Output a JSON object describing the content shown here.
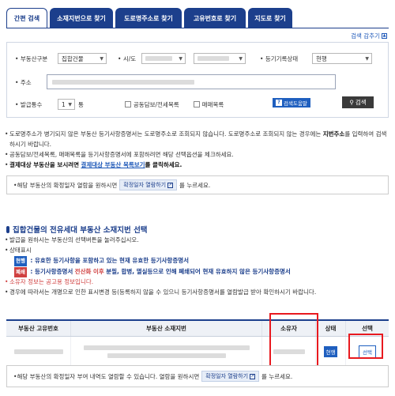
{
  "tabs": [
    {
      "label": "간편 검색",
      "active": true
    },
    {
      "label": "소재지번으로 찾기",
      "active": false
    },
    {
      "label": "도로명주소로 찾기",
      "active": false
    },
    {
      "label": "고유번호로 찾기",
      "active": false
    },
    {
      "label": "지도로 찾기",
      "active": false
    }
  ],
  "search_tip": "검색 감추기",
  "form": {
    "property_type_label": "부동산구분",
    "property_type_value": "집합건물",
    "sido_label": "시/도",
    "registry_status_label": "등기기록상태",
    "registry_status_value": "현행",
    "address_label": "주소",
    "issue_count_label": "발급통수",
    "issue_count_value": "1",
    "issue_unit": "통",
    "joint_collateral": "공동담보/전세목록",
    "trade_list": "매매목록",
    "help_button": "검색도움말",
    "search_button": "검색"
  },
  "notes": {
    "n1": "도로명주소가 병기되지 않은 부동산 등기사항증명서는 도로명주소로 조회되지 않습니다. 도로명주소로 조회되지 않는 경우에는",
    "n1_bold": "지번주소",
    "n1_tail": "를 입력하여 검색하시기 바랍니다.",
    "n2": "공동담보/전세목록, 매매목록을 등기사항증명서에 포함하려면 해당 선택옵션을 체크하세요.",
    "n3_bold": "결제대상 부동산을 보시려면",
    "n3_link": "결제대상 부동산 목록보기",
    "n3_tail": "를 클릭하세요."
  },
  "info1": {
    "prefix": "해당 부동산의 확정일자 열람을 원하시면",
    "button": "확정일자 열람하기",
    "suffix": "를 누르세요."
  },
  "section": {
    "title": "집합건물의 전유세대 부동산 소재지번 선택",
    "l1": "발급을 원하시는 부동산의 선택버튼을 눌러주십시오.",
    "l2": "상태표시",
    "badge_current": "현행",
    "desc_current": ": 유효한 등기사항을 포함하고 있는 현재 유효한 등기사항증명서",
    "badge_closed": "폐쇄",
    "desc_closed_a": ": 등기사항증명서",
    "desc_closed_red": "전산화 이후",
    "desc_closed_b": "분필, 합병, 멸실등으로 인해 폐쇄되어 현재 유효하지 않은 등기사항증명서",
    "l3_red": "소유자 정보는 공고용 정보입니다.",
    "l4": "경우에 따라서는 개명으로 인한 표시변경 등(등록하지 않을 수 있으니 등기사항증명서를 열람발급 받아 확인하시기 바랍니다."
  },
  "table": {
    "headers": [
      "부동산 고유번호",
      "부동산 소재지번",
      "소유자",
      "상태",
      "선택"
    ],
    "row": {
      "status": "현행",
      "select": "선택"
    }
  },
  "info2": {
    "prefix": "해당 부동산의 확정일자 부여 내역도 열람할 수 있습니다. 열람을 원하시면",
    "button": "확정일자 열람하기",
    "suffix": "를 누르세요."
  },
  "colors": {
    "primary": "#1c3f8c",
    "highlight": "#e8191f"
  }
}
